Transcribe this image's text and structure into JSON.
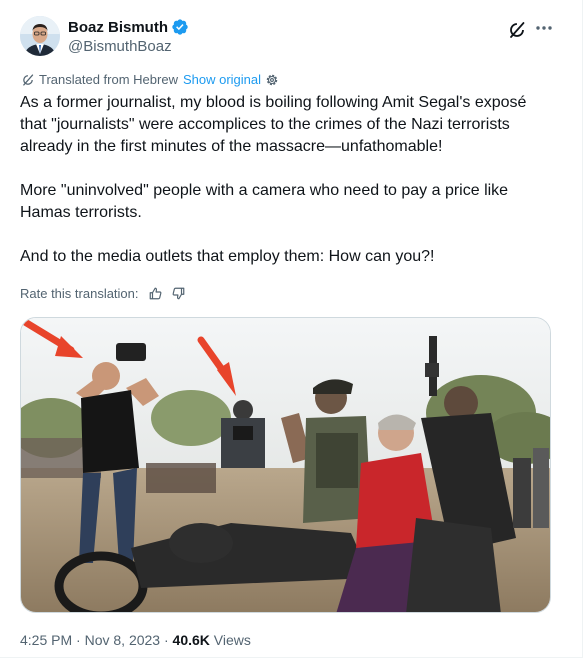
{
  "author": {
    "name": "Boaz Bismuth",
    "handle": "@BismuthBoaz"
  },
  "translation": {
    "label": "Translated from Hebrew",
    "show_original": "Show original"
  },
  "tweet": {
    "paragraphs": [
      "As a former journalist, my blood is boiling following Amit Segal's exposé that \"journalists\" were accomplices to the crimes of the Nazi terrorists already in the first minutes of the massacre—unfathomable!",
      "More \"uninvolved\" people with a camera who need to pay a price like Hamas terrorists.",
      "And to the media outlets that employ them: How can you?!"
    ]
  },
  "rate": {
    "label": "Rate this translation:"
  },
  "meta": {
    "time": "4:25 PM",
    "separator": "·",
    "date": "Nov 8, 2023",
    "views_count": "40.6K",
    "views_label": "Views"
  },
  "icons": {
    "verified": "verified-badge-icon",
    "grok": "grok-icon",
    "more": "more-icon",
    "translate": "translate-icon",
    "settings": "settings-icon",
    "thumbs_up": "thumbs-up-icon",
    "thumbs_down": "thumbs-down-icon"
  },
  "colors": {
    "link": "#1d9bf0",
    "text": "#0f1419",
    "secondary": "#536471",
    "arrow": "#e8442b"
  }
}
